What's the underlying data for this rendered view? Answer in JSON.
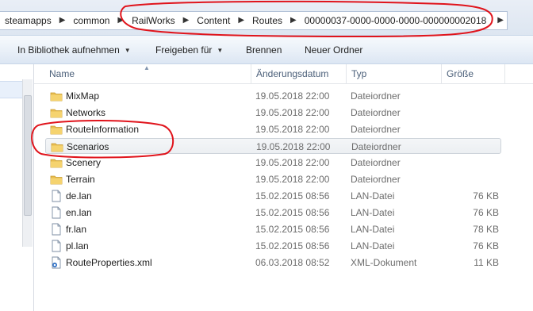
{
  "address": {
    "crumbs": [
      "steamapps",
      "common",
      "RailWorks",
      "Content",
      "Routes",
      "00000037-0000-0000-0000-000000002018"
    ]
  },
  "toolbar": {
    "library": "In Bibliothek aufnehmen",
    "share": "Freigeben für",
    "burn": "Brennen",
    "new_folder": "Neuer Ordner"
  },
  "columns": {
    "name": "Name",
    "date": "Änderungsdatum",
    "type": "Typ",
    "size": "Größe"
  },
  "files": [
    {
      "name": "MixMap",
      "date": "19.05.2018 22:00",
      "type": "Dateiordner",
      "size": "",
      "icon": "folder-icon"
    },
    {
      "name": "Networks",
      "date": "19.05.2018 22:00",
      "type": "Dateiordner",
      "size": "",
      "icon": "folder-icon"
    },
    {
      "name": "RouteInformation",
      "date": "19.05.2018 22:00",
      "type": "Dateiordner",
      "size": "",
      "icon": "folder-icon"
    },
    {
      "name": "Scenarios",
      "date": "19.05.2018 22:00",
      "type": "Dateiordner",
      "size": "",
      "icon": "folder-icon",
      "selected": true
    },
    {
      "name": "Scenery",
      "date": "19.05.2018 22:00",
      "type": "Dateiordner",
      "size": "",
      "icon": "folder-icon"
    },
    {
      "name": "Terrain",
      "date": "19.05.2018 22:00",
      "type": "Dateiordner",
      "size": "",
      "icon": "folder-icon"
    },
    {
      "name": "de.lan",
      "date": "15.02.2015 08:56",
      "type": "LAN-Datei",
      "size": "76 KB",
      "icon": "file-icon"
    },
    {
      "name": "en.lan",
      "date": "15.02.2015 08:56",
      "type": "LAN-Datei",
      "size": "76 KB",
      "icon": "file-icon"
    },
    {
      "name": "fr.lan",
      "date": "15.02.2015 08:56",
      "type": "LAN-Datei",
      "size": "78 KB",
      "icon": "file-icon"
    },
    {
      "name": "pl.lan",
      "date": "15.02.2015 08:56",
      "type": "LAN-Datei",
      "size": "76 KB",
      "icon": "file-icon"
    },
    {
      "name": "RouteProperties.xml",
      "date": "06.03.2018 08:52",
      "type": "XML-Dokument",
      "size": "11 KB",
      "icon": "xml-icon"
    }
  ],
  "colors": {
    "annotation": "#e0141c",
    "folder": "#e8bd52",
    "header_text": "#4c607a"
  }
}
